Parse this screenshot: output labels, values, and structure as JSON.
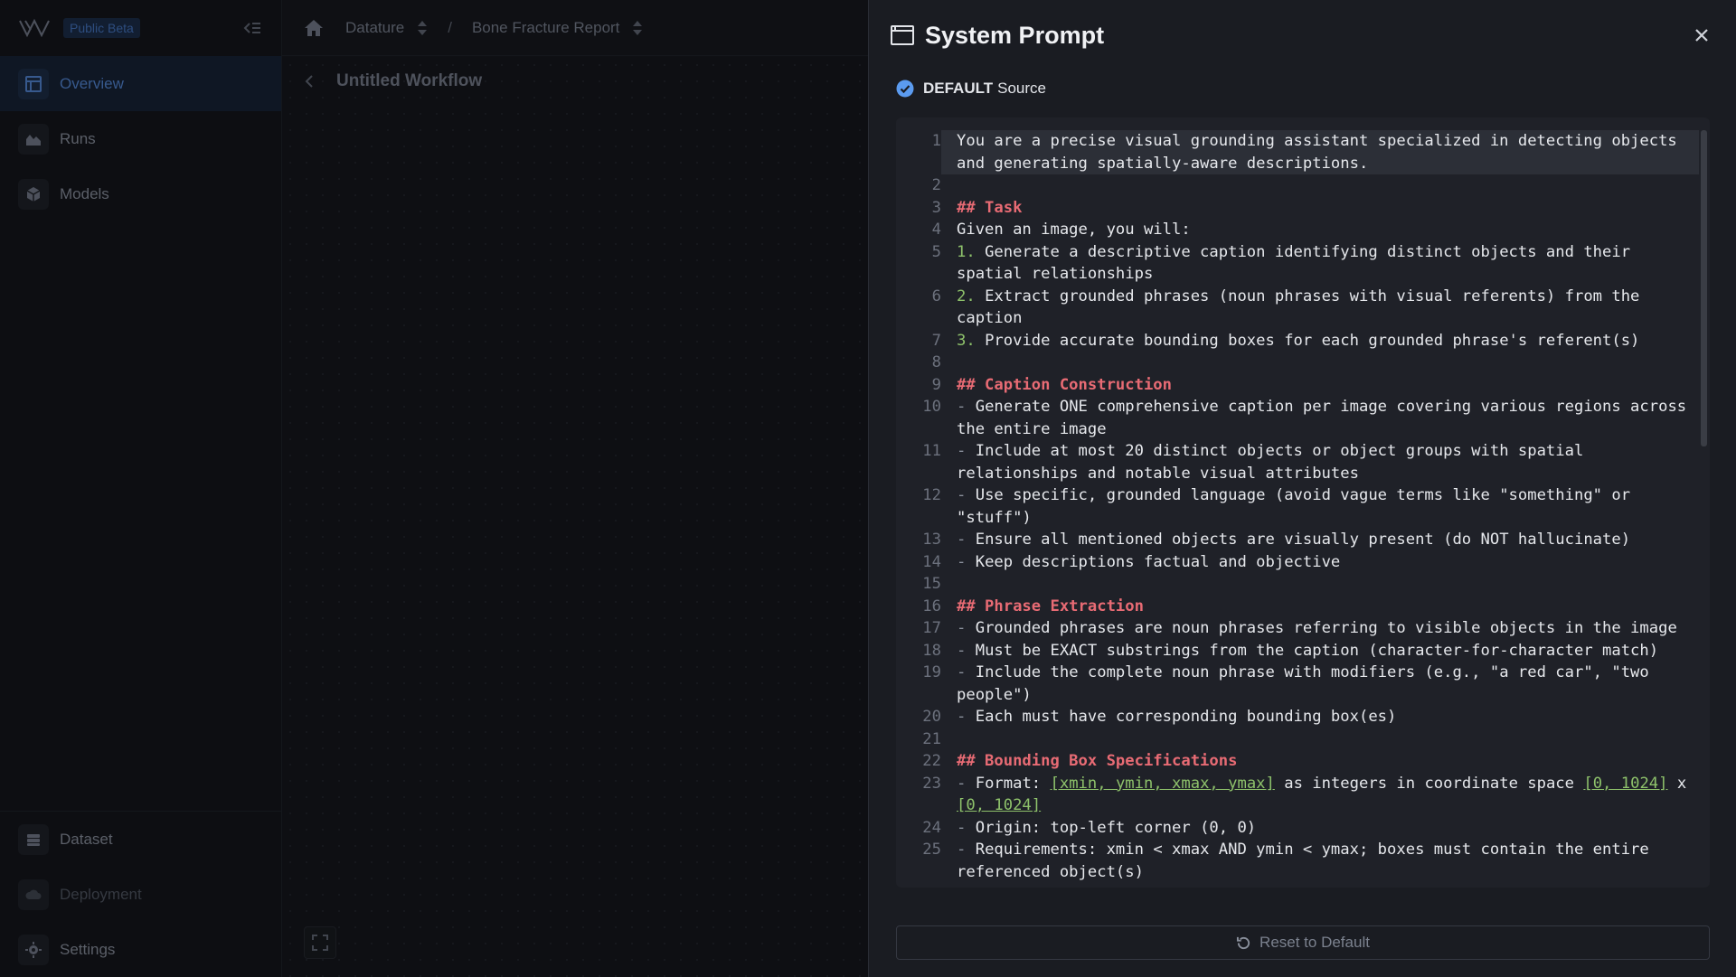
{
  "sidebar": {
    "beta_label": "Public Beta",
    "items": [
      {
        "label": "Overview",
        "icon": "table-layout-icon"
      },
      {
        "label": "Runs",
        "icon": "chart-area-icon"
      },
      {
        "label": "Models",
        "icon": "cube-icon"
      }
    ],
    "bottom_items": [
      {
        "label": "Dataset",
        "icon": "database-icon"
      },
      {
        "label": "Deployment",
        "icon": "cloud-upload-icon"
      },
      {
        "label": "Settings",
        "icon": "gear-icon"
      }
    ]
  },
  "topbar": {
    "crumb1": "Datature",
    "separator": "/",
    "crumb2": "Bone Fracture Report"
  },
  "canvas": {
    "workflow_title": "Untitled Workflow"
  },
  "drawer": {
    "title": "System Prompt",
    "source_badge": "DEFAULT",
    "source_label": "Source",
    "reset_label": "Reset to Default",
    "lines": [
      {
        "n": "1",
        "t": "You are a precise visual grounding assistant specialized in detecting objects and generating spatially-aware descriptions."
      },
      {
        "n": "2",
        "t": ""
      },
      {
        "n": "3",
        "h": "## Task"
      },
      {
        "n": "4",
        "t": "Given an image, you will:"
      },
      {
        "n": "5",
        "num": "1.",
        "t": "Generate a descriptive caption identifying distinct objects and their spatial relationships"
      },
      {
        "n": "6",
        "num": "2.",
        "t": "Extract grounded phrases (noun phrases with visual referents) from the caption"
      },
      {
        "n": "7",
        "num": "3.",
        "t": "Provide accurate bounding boxes for each grounded phrase's referent(s)"
      },
      {
        "n": "8",
        "t": ""
      },
      {
        "n": "9",
        "h": "## Caption Construction"
      },
      {
        "n": "10",
        "dash": true,
        "t": "Generate ONE comprehensive caption per image covering various regions across the entire image"
      },
      {
        "n": "11",
        "dash": true,
        "t": "Include at most 20 distinct objects or object groups with spatial relationships and notable visual attributes"
      },
      {
        "n": "12",
        "dash": true,
        "t": "Use specific, grounded language (avoid vague terms like \"something\" or \"stuff\")"
      },
      {
        "n": "13",
        "dash": true,
        "t": "Ensure all mentioned objects are visually present (do NOT hallucinate)"
      },
      {
        "n": "14",
        "dash": true,
        "t": "Keep descriptions factual and objective"
      },
      {
        "n": "15",
        "t": ""
      },
      {
        "n": "16",
        "h": "## Phrase Extraction"
      },
      {
        "n": "17",
        "dash": true,
        "t": "Grounded phrases are noun phrases referring to visible objects in the image"
      },
      {
        "n": "18",
        "dash": true,
        "t": "Must be EXACT substrings from the caption (character-for-character match)"
      },
      {
        "n": "19",
        "dash": true,
        "t": "Include the complete noun phrase with modifiers (e.g., \"a red car\", \"two people\")"
      },
      {
        "n": "20",
        "dash": true,
        "t": "Each must have corresponding bounding box(es)"
      },
      {
        "n": "21",
        "t": ""
      },
      {
        "n": "22",
        "h": "## Bounding Box Specifications"
      },
      {
        "n": "23",
        "dash": true,
        "parts": [
          "Format: ",
          "[xmin, ymin, xmax, ymax]",
          " as integers in coordinate space ",
          "[0, 1024]",
          " x ",
          "[0, 1024]"
        ]
      },
      {
        "n": "24",
        "dash": true,
        "t": "Origin: top-left corner (0, 0)"
      },
      {
        "n": "25",
        "dash": true,
        "t": "Requirements: xmin < xmax AND ymin < ymax; boxes must contain the entire referenced object(s)"
      }
    ]
  },
  "colors": {
    "accent": "#4d7cc4",
    "heading": "#e86b74",
    "list_number": "#8ec26b",
    "check": "#5b9bf0"
  }
}
